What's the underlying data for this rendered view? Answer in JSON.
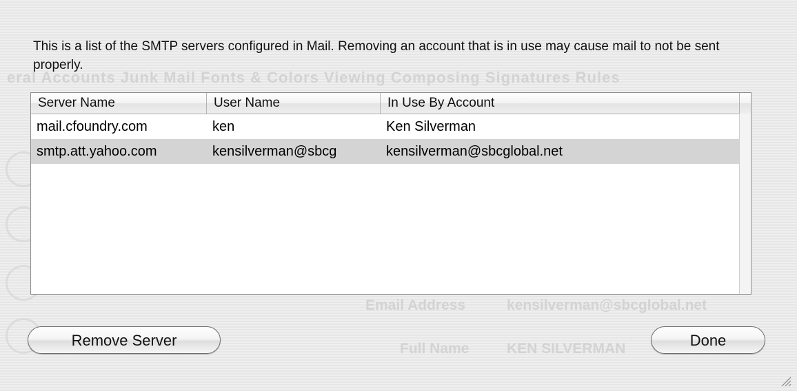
{
  "message": "This is a list of the SMTP servers configured in Mail. Removing an account that is in use may cause mail to not be sent properly.",
  "table": {
    "columns": [
      "Server Name",
      "User Name",
      "In Use By Account"
    ],
    "rows": [
      [
        "mail.cfoundry.com",
        "ken",
        "Ken Silverman"
      ],
      [
        "smtp.att.yahoo.com",
        "kensilverman@sbcg",
        "kensilverman@sbcglobal.net"
      ]
    ],
    "selected_row": 1
  },
  "buttons": {
    "remove": "Remove Server",
    "done": "Done"
  },
  "background": {
    "toolbar": "eral  Accounts  Junk Mail  Fonts & Colors  Viewing  Composing  Signatures  Rules",
    "email_label": "Email Address",
    "email_value": "kensilverman@sbcglobal.net",
    "fullname_label": "Full Name",
    "fullname_value": "KEN SILVERMAN"
  },
  "colors": {
    "selection": "#d4d4d4",
    "window_bg": "#ececec"
  }
}
